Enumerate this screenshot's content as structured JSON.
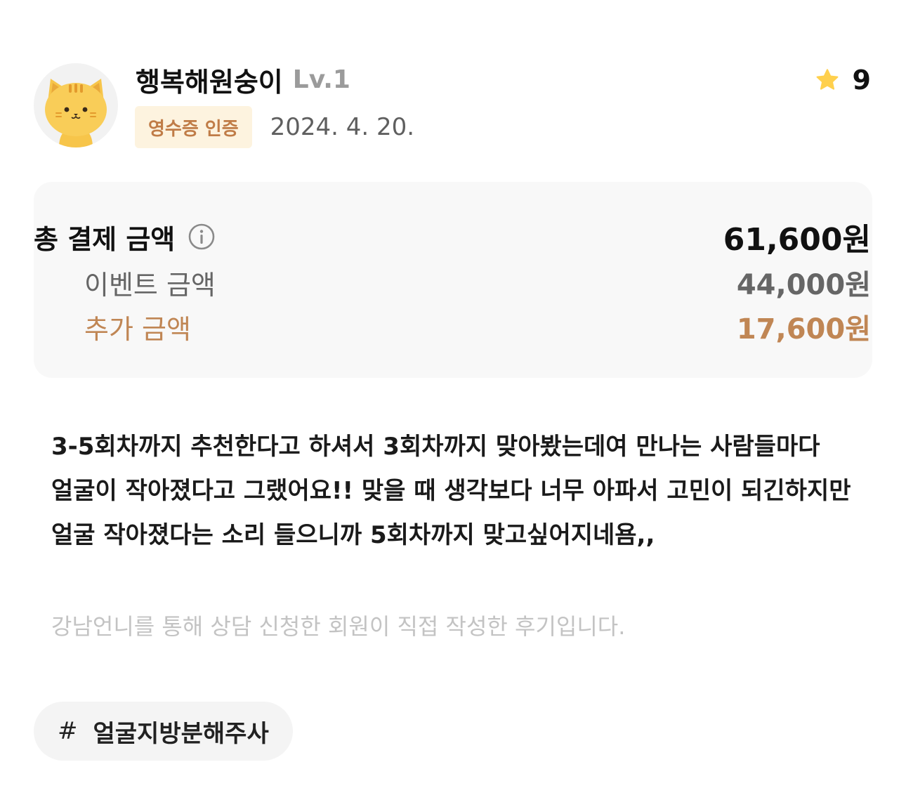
{
  "user": {
    "nickname": "행복해원숭이",
    "level": "Lv.1",
    "avatar": "cat-avatar-icon"
  },
  "review": {
    "badge": "영수증 인증",
    "date": "2024. 4. 20.",
    "rating": "9",
    "body": "3-5회차까지 추천한다고 하셔서 3회차까지 맞아봤는데여 만나는 사람들마다 얼굴이 작아졌다고 그랬어요!! 맞을 때 생각보다 너무 아파서 고민이 되긴하지만 얼굴 작아졌다는 소리 들으니까 5회차까지 맞고싶어지네욤,,",
    "notice": "강남언니를 통해 상담 신청한 회원이 직접 작성한 후기입니다."
  },
  "price": {
    "total_label": "총 결제 금액",
    "total_value": "61,600원",
    "event_label": "이벤트 금액",
    "event_value": "44,000원",
    "extra_label": "추가 금액",
    "extra_value": "17,600원"
  },
  "hashtag": {
    "symbol": "#",
    "label": "얼굴지방분해주사"
  },
  "colors": {
    "badge_bg": "#fdf3df",
    "badge_text": "#c07c47",
    "star": "#ffd04d",
    "extra_amount": "#c08654",
    "box_bg": "#f8f8f8"
  }
}
